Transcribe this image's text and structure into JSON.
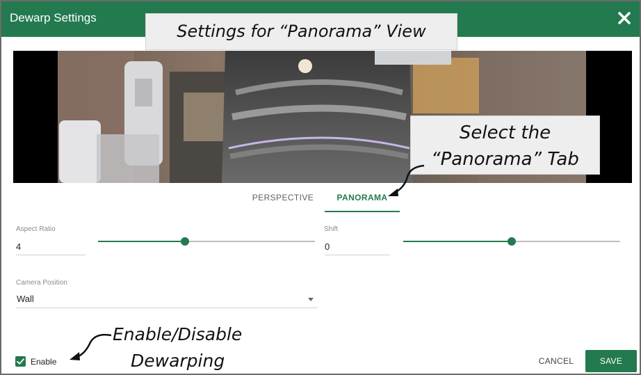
{
  "dialog": {
    "title": "Dewarp Settings"
  },
  "tabs": [
    {
      "label": "PERSPECTIVE",
      "active": false
    },
    {
      "label": "PANORAMA",
      "active": true
    }
  ],
  "fields": {
    "aspect_ratio": {
      "label": "Aspect Ratio",
      "value": "4",
      "slider_fraction": 0.4
    },
    "shift": {
      "label": "Shift",
      "value": "0",
      "slider_fraction": 0.5
    },
    "camera_position": {
      "label": "Camera Position",
      "value": "Wall"
    }
  },
  "enable": {
    "label": "Enable",
    "checked": true
  },
  "buttons": {
    "cancel": "CANCEL",
    "save": "SAVE"
  },
  "annotations": {
    "settings_view": "Settings for “Panorama” View",
    "select_tab_line1": "Select the",
    "select_tab_line2": "“Panorama” Tab",
    "dewarp_line1": "Enable/Disable",
    "dewarp_line2": "Dewarping"
  },
  "colors": {
    "accent": "#237a4f",
    "callout_bg": "#eeeeee"
  },
  "icons": {
    "close": "close-icon",
    "check": "check-icon",
    "caret": "chevron-down-icon"
  }
}
